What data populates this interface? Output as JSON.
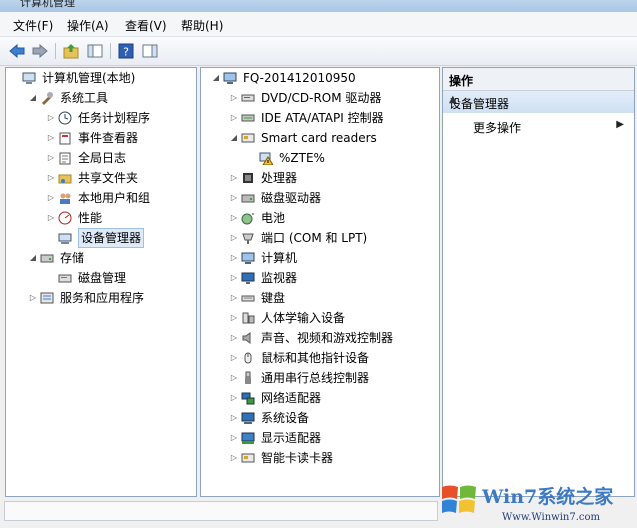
{
  "window": {
    "title": "计算机管理"
  },
  "menu": {
    "items": [
      "文件(F)",
      "操作(A)",
      "查看(V)",
      "帮助(H)"
    ]
  },
  "left_tree": [
    {
      "label": "计算机管理(本地)",
      "icon": "computer-management-icon",
      "indent": 0,
      "expander": ""
    },
    {
      "label": "系统工具",
      "icon": "tools-icon",
      "indent": 1,
      "expander": "down"
    },
    {
      "label": "任务计划程序",
      "icon": "clock-icon",
      "indent": 2,
      "expander": "right"
    },
    {
      "label": "事件查看器",
      "icon": "event-viewer-icon",
      "indent": 2,
      "expander": "right"
    },
    {
      "label": "全局日志",
      "icon": "log-icon",
      "indent": 2,
      "expander": "right"
    },
    {
      "label": "共享文件夹",
      "icon": "shared-folder-icon",
      "indent": 2,
      "expander": "right"
    },
    {
      "label": "本地用户和组",
      "icon": "users-icon",
      "indent": 2,
      "expander": "right"
    },
    {
      "label": "性能",
      "icon": "performance-icon",
      "indent": 2,
      "expander": "right"
    },
    {
      "label": "设备管理器",
      "icon": "device-manager-icon",
      "indent": 2,
      "expander": "",
      "selected": true
    },
    {
      "label": "存储",
      "icon": "storage-icon",
      "indent": 1,
      "expander": "down"
    },
    {
      "label": "磁盘管理",
      "icon": "disk-management-icon",
      "indent": 2,
      "expander": ""
    },
    {
      "label": "服务和应用程序",
      "icon": "services-icon",
      "indent": 1,
      "expander": "right"
    }
  ],
  "device_tree": [
    {
      "label": "FQ-201412010950",
      "icon": "computer-icon",
      "indent": 0,
      "expander": "down"
    },
    {
      "label": "DVD/CD-ROM 驱动器",
      "icon": "dvd-drive-icon",
      "indent": 1,
      "expander": "right"
    },
    {
      "label": "IDE ATA/ATAPI 控制器",
      "icon": "ide-controller-icon",
      "indent": 1,
      "expander": "right"
    },
    {
      "label": "Smart card readers",
      "icon": "smart-card-reader-icon",
      "indent": 1,
      "expander": "down"
    },
    {
      "label": "%ZTE%",
      "icon": "warning-device-icon",
      "indent": 2,
      "expander": ""
    },
    {
      "label": "处理器",
      "icon": "processor-icon",
      "indent": 1,
      "expander": "right"
    },
    {
      "label": "磁盘驱动器",
      "icon": "disk-drive-icon",
      "indent": 1,
      "expander": "right"
    },
    {
      "label": "电池",
      "icon": "battery-icon",
      "indent": 1,
      "expander": "right"
    },
    {
      "label": "端口 (COM 和 LPT)",
      "icon": "port-icon",
      "indent": 1,
      "expander": "right"
    },
    {
      "label": "计算机",
      "icon": "computer-icon",
      "indent": 1,
      "expander": "right"
    },
    {
      "label": "监视器",
      "icon": "monitor-icon",
      "indent": 1,
      "expander": "right"
    },
    {
      "label": "键盘",
      "icon": "keyboard-icon",
      "indent": 1,
      "expander": "right"
    },
    {
      "label": "人体学输入设备",
      "icon": "hid-icon",
      "indent": 1,
      "expander": "right"
    },
    {
      "label": "声音、视频和游戏控制器",
      "icon": "sound-icon",
      "indent": 1,
      "expander": "right"
    },
    {
      "label": "鼠标和其他指针设备",
      "icon": "mouse-icon",
      "indent": 1,
      "expander": "right"
    },
    {
      "label": "通用串行总线控制器",
      "icon": "usb-icon",
      "indent": 1,
      "expander": "right"
    },
    {
      "label": "网络适配器",
      "icon": "network-adapter-icon",
      "indent": 1,
      "expander": "right"
    },
    {
      "label": "系统设备",
      "icon": "system-device-icon",
      "indent": 1,
      "expander": "right"
    },
    {
      "label": "显示适配器",
      "icon": "display-adapter-icon",
      "indent": 1,
      "expander": "right"
    },
    {
      "label": "智能卡读卡器",
      "icon": "smart-card-reader-icon",
      "indent": 1,
      "expander": "right"
    }
  ],
  "actions": {
    "header": "操作",
    "section": "设备管理器",
    "more": "更多操作"
  },
  "watermark": {
    "brand": "Win7系统之家",
    "url": "Www.Winwin7.com"
  },
  "colors": {
    "accent": "#3d6fb5",
    "selection": "#dfeaf8",
    "pane_border": "#8ea3bd"
  }
}
